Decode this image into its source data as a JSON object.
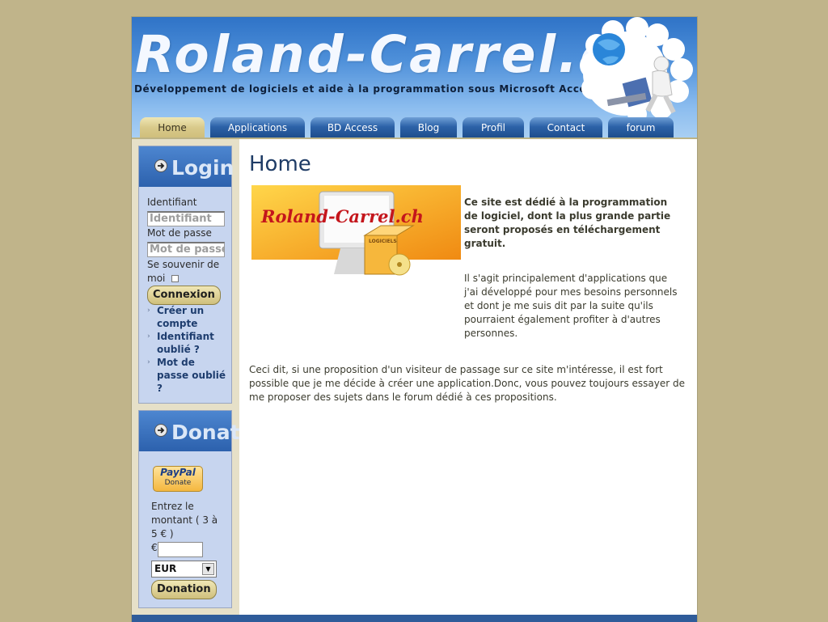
{
  "header": {
    "title": "Roland-Carrel.ch",
    "subtitle": "Développement de logiciels et aide à la programmation sous Microsoft Access, Delphi et VBA"
  },
  "nav": {
    "tabs": [
      {
        "label": "Home",
        "active": true
      },
      {
        "label": "Applications",
        "active": false
      },
      {
        "label": "BD Access",
        "active": false
      },
      {
        "label": "Blog",
        "active": false
      },
      {
        "label": "Profil",
        "active": false
      },
      {
        "label": "Contact",
        "active": false
      },
      {
        "label": "forum",
        "active": false
      }
    ]
  },
  "login": {
    "title": "Login Form",
    "username_label": "Identifiant",
    "username_placeholder": "Identifiant",
    "password_label": "Mot de passe",
    "password_placeholder": "Mot de passe",
    "remember_label": "Se souvenir de moi",
    "remember_checked": false,
    "submit_label": "Connexion",
    "links": [
      "Créer un compte",
      "Identifiant oublié ?",
      "Mot de passe oublié ?"
    ]
  },
  "donation": {
    "title": "Donation",
    "paypal_line1": "PayPal",
    "paypal_line2": "Donate",
    "amount_label": "Entrez le montant ( 3 à 5 € )",
    "currency_symbol": "€",
    "amount_value": "",
    "currency_selected": "EUR",
    "submit_label": "Donation"
  },
  "main": {
    "page_title": "Home",
    "logo_text": "Roland-Carrel.ch",
    "logo_box_label": "LOGICIELS",
    "intro_bold": "Ce site est dédié à la programmation de logiciel, dont la plus grande partie seront proposés en téléchargement gratuit.",
    "paragraph2": "Il s'agit principalement d'applications que j'ai développé pour mes besoins personnels et dont je me suis dit par la suite qu'ils pourraient également profiter à d'autres personnes.",
    "paragraph3": "Ceci dit, si une proposition d'un visiteur de passage sur ce site m'intéresse, il est fort possible que je me décide à créer une application.Donc, vous pouvez toujours essayer de me proposer des sujets dans le forum dédié à ces propositions."
  },
  "colors": {
    "page_background": "#c0b48a",
    "header_blue": "#2f73c7",
    "nav_active": "#d8c98a",
    "module_background": "#c7d5ef"
  }
}
